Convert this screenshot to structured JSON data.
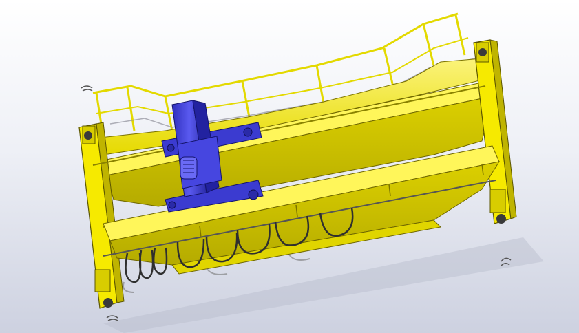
{
  "scene": {
    "subject": "double-girder-overhead-crane-3d-model",
    "colors": {
      "background_top": "#ffffff",
      "background_bottom": "#cdd1e0",
      "structure": "#f2e600",
      "structure_shade": "#c9be00",
      "structure_dark": "#8e8400",
      "trolley": "#3d3dd6",
      "trolley_dark": "#23238f",
      "cable": "#333333",
      "outline": "#2a2a00"
    }
  }
}
